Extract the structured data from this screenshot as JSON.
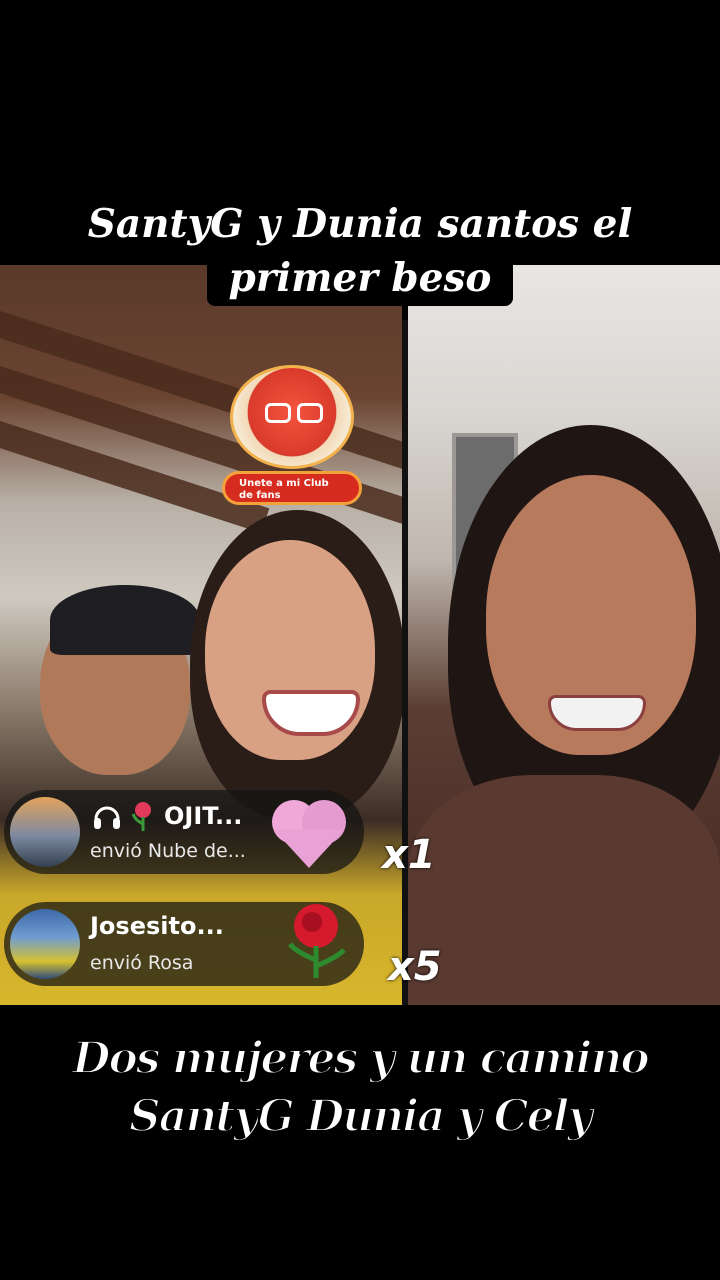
{
  "caption_top": {
    "line1": "SantyG y Dunia santos el",
    "line2": "primer beso"
  },
  "fan_club": {
    "label": "Unete a mi Club de fans"
  },
  "gifts": [
    {
      "user": "OJIT...",
      "message": "envió Nube de...",
      "count": "x1",
      "icons": [
        "headphones-icon",
        "rose-icon"
      ]
    },
    {
      "user": "Josesito...",
      "message": "envió Rosa",
      "count": "x5",
      "icons": []
    }
  ],
  "caption_bottom": {
    "line1": "Dos mujeres y un camino",
    "line2": "SantyG Dunia y Cely"
  }
}
